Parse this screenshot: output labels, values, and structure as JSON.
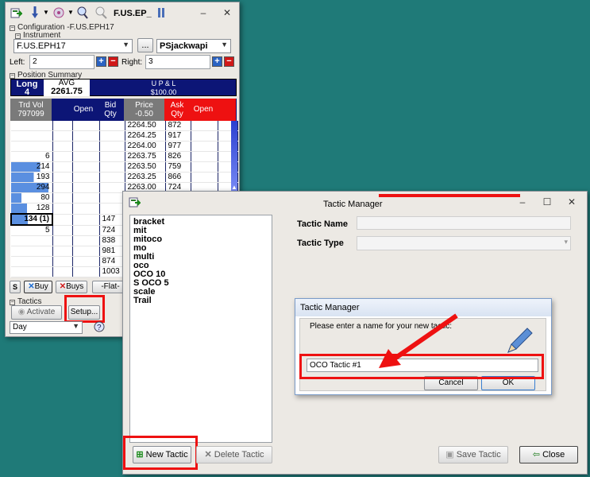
{
  "ladder_window": {
    "title": "F.US.EP_",
    "config_label": "Configuration -F.US.EPH17",
    "instrument_label": "Instrument",
    "instrument_value": "F.US.EPH17",
    "browse_label": "...",
    "account_value": "PSjackwapi",
    "left_label": "Left:",
    "left_value": "2",
    "right_label": "Right:",
    "right_value": "3",
    "position_label": "Position Summary",
    "position": {
      "long_label": "Long",
      "long_value": "4",
      "avg_label": "AVG",
      "avg_value": "2261.75",
      "upl_label": "U P & L",
      "upl_value": "$100.00"
    },
    "headers": {
      "trd_vol": "Trd Vol",
      "trd_vol_total": "797099",
      "open_left": "Open",
      "bid_qty": "Bid",
      "bid_qty2": "Qty",
      "price": "Price",
      "price_offset": "-0.50",
      "ask_qty": "Ask",
      "ask_qty2": "Qty",
      "open_right": "Open"
    },
    "rows": [
      {
        "vol": "",
        "bid": "",
        "price": "2264.50",
        "ask": "872"
      },
      {
        "vol": "",
        "bid": "",
        "price": "2264.25",
        "ask": "917"
      },
      {
        "vol": "",
        "bid": "",
        "price": "2264.00",
        "ask": "977"
      },
      {
        "vol": "6",
        "bid": "",
        "price": "2263.75",
        "ask": "826"
      },
      {
        "vol": "214",
        "bid": "",
        "price": "2263.50",
        "ask": "759"
      },
      {
        "vol": "193",
        "bid": "",
        "price": "2263.25",
        "ask": "866"
      },
      {
        "vol": "294",
        "bid": "",
        "price": "2263.00",
        "ask": "724"
      },
      {
        "vol": "80",
        "bid": "",
        "price": "",
        "ask": ""
      },
      {
        "vol": "128",
        "bid": "",
        "price": "",
        "ask": ""
      },
      {
        "vol": "134 (1)",
        "bid": "147",
        "price": "",
        "ask": ""
      },
      {
        "vol": "5",
        "bid": "724",
        "price": "",
        "ask": ""
      },
      {
        "vol": "",
        "bid": "838",
        "price": "",
        "ask": ""
      },
      {
        "vol": "",
        "bid": "981",
        "price": "",
        "ask": ""
      },
      {
        "vol": "",
        "bid": "874",
        "price": "",
        "ask": ""
      },
      {
        "vol": "",
        "bid": "1003",
        "price": "",
        "ask": ""
      }
    ],
    "s_label": "S",
    "buy_label": "Buy",
    "buys_label": "Buys",
    "flat_label": "-Flat-",
    "tactics_label": "Tactics",
    "activate_label": "Activate",
    "setup_label": "Setup...",
    "period_value": "Day"
  },
  "tactic_manager": {
    "title": "Tactic Manager",
    "tactics": [
      "bracket",
      "mit",
      "mitoco",
      "mo",
      "multi",
      "oco",
      "OCO 10",
      "S OCO 5",
      "scale",
      "Trail"
    ],
    "name_label": "Tactic Name",
    "type_label": "Tactic Type",
    "new_tactic_label": "New Tactic",
    "delete_tactic_label": "Delete Tactic",
    "save_tactic_label": "Save Tactic",
    "close_label": "Close"
  },
  "dialog": {
    "title": "Tactic Manager",
    "prompt": "Please enter a name for your new tactic:",
    "input_value": "OCO Tactic #1",
    "cancel_label": "Cancel",
    "ok_label": "OK"
  },
  "colors": {
    "background": "#1f7a78",
    "ladder_navy": "#0c1576",
    "ask_red": "#ee1111",
    "vol_blue": "#5a8fe0",
    "highlight": "#e11111"
  }
}
